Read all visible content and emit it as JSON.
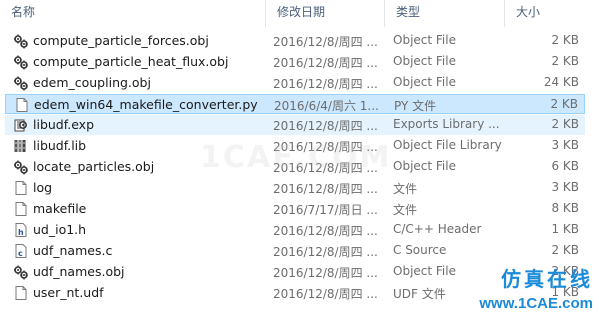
{
  "columns": {
    "name": "名称",
    "date": "修改日期",
    "type": "类型",
    "size": "大小"
  },
  "files": [
    {
      "name": "compute_particle_forces.obj",
      "date": "2016/12/8/周四 ...",
      "type": "Object File",
      "size": "2 KB",
      "icon": "object-file-icon"
    },
    {
      "name": "compute_particle_heat_flux.obj",
      "date": "2016/12/8/周四 ...",
      "type": "Object File",
      "size": "2 KB",
      "icon": "object-file-icon"
    },
    {
      "name": "edem_coupling.obj",
      "date": "2016/12/8/周四 ...",
      "type": "Object File",
      "size": "24 KB",
      "icon": "object-file-icon"
    },
    {
      "name": "edem_win64_makefile_converter.py",
      "date": "2016/6/4/周六 1...",
      "type": "PY 文件",
      "size": "2 KB",
      "icon": "py-file-icon"
    },
    {
      "name": "libudf.exp",
      "date": "2016/12/8/周四 ...",
      "type": "Exports Library ...",
      "size": "2 KB",
      "icon": "exports-file-icon"
    },
    {
      "name": "libudf.lib",
      "date": "2016/12/8/周四 ...",
      "type": "Object File Library",
      "size": "3 KB",
      "icon": "library-file-icon"
    },
    {
      "name": "locate_particles.obj",
      "date": "2016/12/8/周四 ...",
      "type": "Object File",
      "size": "6 KB",
      "icon": "object-file-icon"
    },
    {
      "name": "log",
      "date": "2016/12/8/周四 ...",
      "type": "文件",
      "size": "3 KB",
      "icon": "blank-file-icon"
    },
    {
      "name": "makefile",
      "date": "2016/7/17/周日 ...",
      "type": "文件",
      "size": "8 KB",
      "icon": "blank-file-icon"
    },
    {
      "name": "ud_io1.h",
      "date": "2016/12/8/周四 ...",
      "type": "C/C++ Header",
      "size": "1 KB",
      "icon": "header-file-icon"
    },
    {
      "name": "udf_names.c",
      "date": "2016/12/8/周四 ...",
      "type": "C Source",
      "size": "2 KB",
      "icon": "c-source-file-icon"
    },
    {
      "name": "udf_names.obj",
      "date": "2016/12/8/周四 ...",
      "type": "Object File",
      "size": "2 KB",
      "icon": "object-file-icon"
    },
    {
      "name": "user_nt.udf",
      "date": "2016/12/8/周四 ...",
      "type": "UDF 文件",
      "size": "1 KB",
      "icon": "blank-file-icon"
    }
  ],
  "selected_index": 3,
  "hover_index": 4,
  "branding": {
    "watermark": "1CAE.COM",
    "corner_brand": "仿真在线",
    "corner_url": "www.1CAE.com"
  },
  "colors": {
    "selected_bg": "#cce8ff",
    "selected_border": "#99d1ff",
    "hover_bg": "#e5f3ff",
    "header_text": "#4c607a",
    "brand": "#1a8ad9"
  }
}
